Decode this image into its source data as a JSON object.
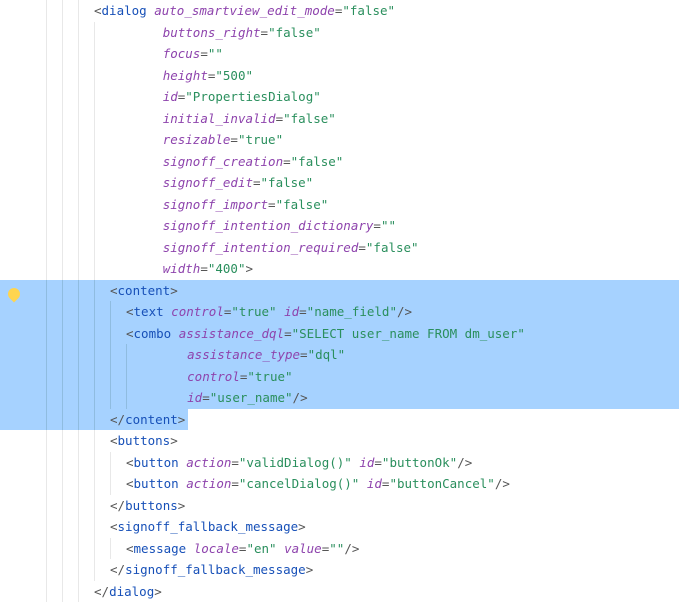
{
  "lines": [
    {
      "indent": 3,
      "sel": false,
      "tokens": [
        {
          "t": "p",
          "v": "<"
        },
        {
          "t": "tg",
          "v": "dialog"
        },
        {
          "t": "c",
          "v": " "
        },
        {
          "t": "at",
          "v": "auto_smartview_edit_mode"
        },
        {
          "t": "eq",
          "v": "="
        },
        {
          "t": "vs",
          "v": "\"false\""
        }
      ]
    },
    {
      "indent": 3,
      "sel": false,
      "cont": true,
      "tokens": [
        {
          "t": "at",
          "v": "buttons_right"
        },
        {
          "t": "eq",
          "v": "="
        },
        {
          "t": "vs",
          "v": "\"false\""
        }
      ]
    },
    {
      "indent": 3,
      "sel": false,
      "cont": true,
      "tokens": [
        {
          "t": "at",
          "v": "focus"
        },
        {
          "t": "eq",
          "v": "="
        },
        {
          "t": "vs",
          "v": "\"\""
        }
      ]
    },
    {
      "indent": 3,
      "sel": false,
      "cont": true,
      "tokens": [
        {
          "t": "at",
          "v": "height"
        },
        {
          "t": "eq",
          "v": "="
        },
        {
          "t": "vs",
          "v": "\"500\""
        }
      ]
    },
    {
      "indent": 3,
      "sel": false,
      "cont": true,
      "tokens": [
        {
          "t": "at",
          "v": "id"
        },
        {
          "t": "eq",
          "v": "="
        },
        {
          "t": "vs",
          "v": "\"PropertiesDialog\""
        }
      ]
    },
    {
      "indent": 3,
      "sel": false,
      "cont": true,
      "tokens": [
        {
          "t": "at",
          "v": "initial_invalid"
        },
        {
          "t": "eq",
          "v": "="
        },
        {
          "t": "vs",
          "v": "\"false\""
        }
      ]
    },
    {
      "indent": 3,
      "sel": false,
      "cont": true,
      "tokens": [
        {
          "t": "at",
          "v": "resizable"
        },
        {
          "t": "eq",
          "v": "="
        },
        {
          "t": "vs",
          "v": "\"true\""
        }
      ]
    },
    {
      "indent": 3,
      "sel": false,
      "cont": true,
      "tokens": [
        {
          "t": "at",
          "v": "signoff_creation"
        },
        {
          "t": "eq",
          "v": "="
        },
        {
          "t": "vs",
          "v": "\"false\""
        }
      ]
    },
    {
      "indent": 3,
      "sel": false,
      "cont": true,
      "tokens": [
        {
          "t": "at",
          "v": "signoff_edit"
        },
        {
          "t": "eq",
          "v": "="
        },
        {
          "t": "vs",
          "v": "\"false\""
        }
      ]
    },
    {
      "indent": 3,
      "sel": false,
      "cont": true,
      "tokens": [
        {
          "t": "at",
          "v": "signoff_import"
        },
        {
          "t": "eq",
          "v": "="
        },
        {
          "t": "vs",
          "v": "\"false\""
        }
      ]
    },
    {
      "indent": 3,
      "sel": false,
      "cont": true,
      "tokens": [
        {
          "t": "at",
          "v": "signoff_intention_dictionary"
        },
        {
          "t": "eq",
          "v": "="
        },
        {
          "t": "vs",
          "v": "\"\""
        }
      ]
    },
    {
      "indent": 3,
      "sel": false,
      "cont": true,
      "tokens": [
        {
          "t": "at",
          "v": "signoff_intention_required"
        },
        {
          "t": "eq",
          "v": "="
        },
        {
          "t": "vs",
          "v": "\"false\""
        }
      ]
    },
    {
      "indent": 3,
      "sel": false,
      "cont": true,
      "tokens": [
        {
          "t": "at",
          "v": "width"
        },
        {
          "t": "eq",
          "v": "="
        },
        {
          "t": "vs",
          "v": "\"400\""
        },
        {
          "t": "p",
          "v": ">"
        }
      ]
    },
    {
      "indent": 4,
      "sel": true,
      "tokens": [
        {
          "t": "p",
          "v": "<"
        },
        {
          "t": "tg",
          "v": "content"
        },
        {
          "t": "p",
          "v": ">"
        }
      ]
    },
    {
      "indent": 5,
      "sel": true,
      "tokens": [
        {
          "t": "p",
          "v": "<"
        },
        {
          "t": "tg",
          "v": "text"
        },
        {
          "t": "c",
          "v": " "
        },
        {
          "t": "at",
          "v": "control"
        },
        {
          "t": "eq",
          "v": "="
        },
        {
          "t": "vs",
          "v": "\"true\""
        },
        {
          "t": "c",
          "v": " "
        },
        {
          "t": "at",
          "v": "id"
        },
        {
          "t": "eq",
          "v": "="
        },
        {
          "t": "vs",
          "v": "\"name_field\""
        },
        {
          "t": "p",
          "v": "/>"
        }
      ]
    },
    {
      "indent": 5,
      "sel": true,
      "tokens": [
        {
          "t": "p",
          "v": "<"
        },
        {
          "t": "tg",
          "v": "combo"
        },
        {
          "t": "c",
          "v": " "
        },
        {
          "t": "at",
          "v": "assistance_dql"
        },
        {
          "t": "eq",
          "v": "="
        },
        {
          "t": "vs",
          "v": "\"SELECT user_name FROM dm_user\""
        }
      ]
    },
    {
      "indent": 5,
      "sel": true,
      "cont": true,
      "tokens": [
        {
          "t": "at",
          "v": "assistance_type"
        },
        {
          "t": "eq",
          "v": "="
        },
        {
          "t": "vs",
          "v": "\"dql\""
        }
      ]
    },
    {
      "indent": 5,
      "sel": true,
      "cont": true,
      "tokens": [
        {
          "t": "at",
          "v": "control"
        },
        {
          "t": "eq",
          "v": "="
        },
        {
          "t": "vs",
          "v": "\"true\""
        }
      ]
    },
    {
      "indent": 5,
      "sel": true,
      "cont": true,
      "tokens": [
        {
          "t": "at",
          "v": "id"
        },
        {
          "t": "eq",
          "v": "="
        },
        {
          "t": "vs",
          "v": "\"user_name\""
        },
        {
          "t": "p",
          "v": "/>"
        }
      ]
    },
    {
      "indent": 4,
      "sel": true,
      "selPartial": true,
      "tokens": [
        {
          "t": "p",
          "v": "</"
        },
        {
          "t": "tg",
          "v": "content"
        },
        {
          "t": "p",
          "v": ">"
        }
      ]
    },
    {
      "indent": 4,
      "sel": false,
      "tokens": [
        {
          "t": "p",
          "v": "<"
        },
        {
          "t": "tg",
          "v": "buttons"
        },
        {
          "t": "p",
          "v": ">"
        }
      ]
    },
    {
      "indent": 5,
      "sel": false,
      "tokens": [
        {
          "t": "p",
          "v": "<"
        },
        {
          "t": "tg",
          "v": "button"
        },
        {
          "t": "c",
          "v": " "
        },
        {
          "t": "at",
          "v": "action"
        },
        {
          "t": "eq",
          "v": "="
        },
        {
          "t": "vs",
          "v": "\"validDialog()\""
        },
        {
          "t": "c",
          "v": " "
        },
        {
          "t": "at",
          "v": "id"
        },
        {
          "t": "eq",
          "v": "="
        },
        {
          "t": "vs",
          "v": "\"buttonOk\""
        },
        {
          "t": "p",
          "v": "/>"
        }
      ]
    },
    {
      "indent": 5,
      "sel": false,
      "tokens": [
        {
          "t": "p",
          "v": "<"
        },
        {
          "t": "tg",
          "v": "button"
        },
        {
          "t": "c",
          "v": " "
        },
        {
          "t": "at",
          "v": "action"
        },
        {
          "t": "eq",
          "v": "="
        },
        {
          "t": "vs",
          "v": "\"cancelDialog()\""
        },
        {
          "t": "c",
          "v": " "
        },
        {
          "t": "at",
          "v": "id"
        },
        {
          "t": "eq",
          "v": "="
        },
        {
          "t": "vs",
          "v": "\"buttonCancel\""
        },
        {
          "t": "p",
          "v": "/>"
        }
      ]
    },
    {
      "indent": 4,
      "sel": false,
      "tokens": [
        {
          "t": "p",
          "v": "</"
        },
        {
          "t": "tg",
          "v": "buttons"
        },
        {
          "t": "p",
          "v": ">"
        }
      ]
    },
    {
      "indent": 4,
      "sel": false,
      "tokens": [
        {
          "t": "p",
          "v": "<"
        },
        {
          "t": "tg",
          "v": "signoff_fallback_message"
        },
        {
          "t": "p",
          "v": ">"
        }
      ]
    },
    {
      "indent": 5,
      "sel": false,
      "tokens": [
        {
          "t": "p",
          "v": "<"
        },
        {
          "t": "tg",
          "v": "message"
        },
        {
          "t": "c",
          "v": " "
        },
        {
          "t": "at",
          "v": "locale"
        },
        {
          "t": "eq",
          "v": "="
        },
        {
          "t": "vs",
          "v": "\"en\""
        },
        {
          "t": "c",
          "v": " "
        },
        {
          "t": "at",
          "v": "value"
        },
        {
          "t": "eq",
          "v": "="
        },
        {
          "t": "vs",
          "v": "\"\""
        },
        {
          "t": "p",
          "v": "/>"
        }
      ]
    },
    {
      "indent": 4,
      "sel": false,
      "tokens": [
        {
          "t": "p",
          "v": "</"
        },
        {
          "t": "tg",
          "v": "signoff_fallback_message"
        },
        {
          "t": "p",
          "v": ">"
        }
      ]
    },
    {
      "indent": 3,
      "sel": false,
      "tokens": [
        {
          "t": "p",
          "v": "</"
        },
        {
          "t": "tg",
          "v": "dialog"
        },
        {
          "t": "p",
          "v": ">"
        }
      ]
    }
  ]
}
